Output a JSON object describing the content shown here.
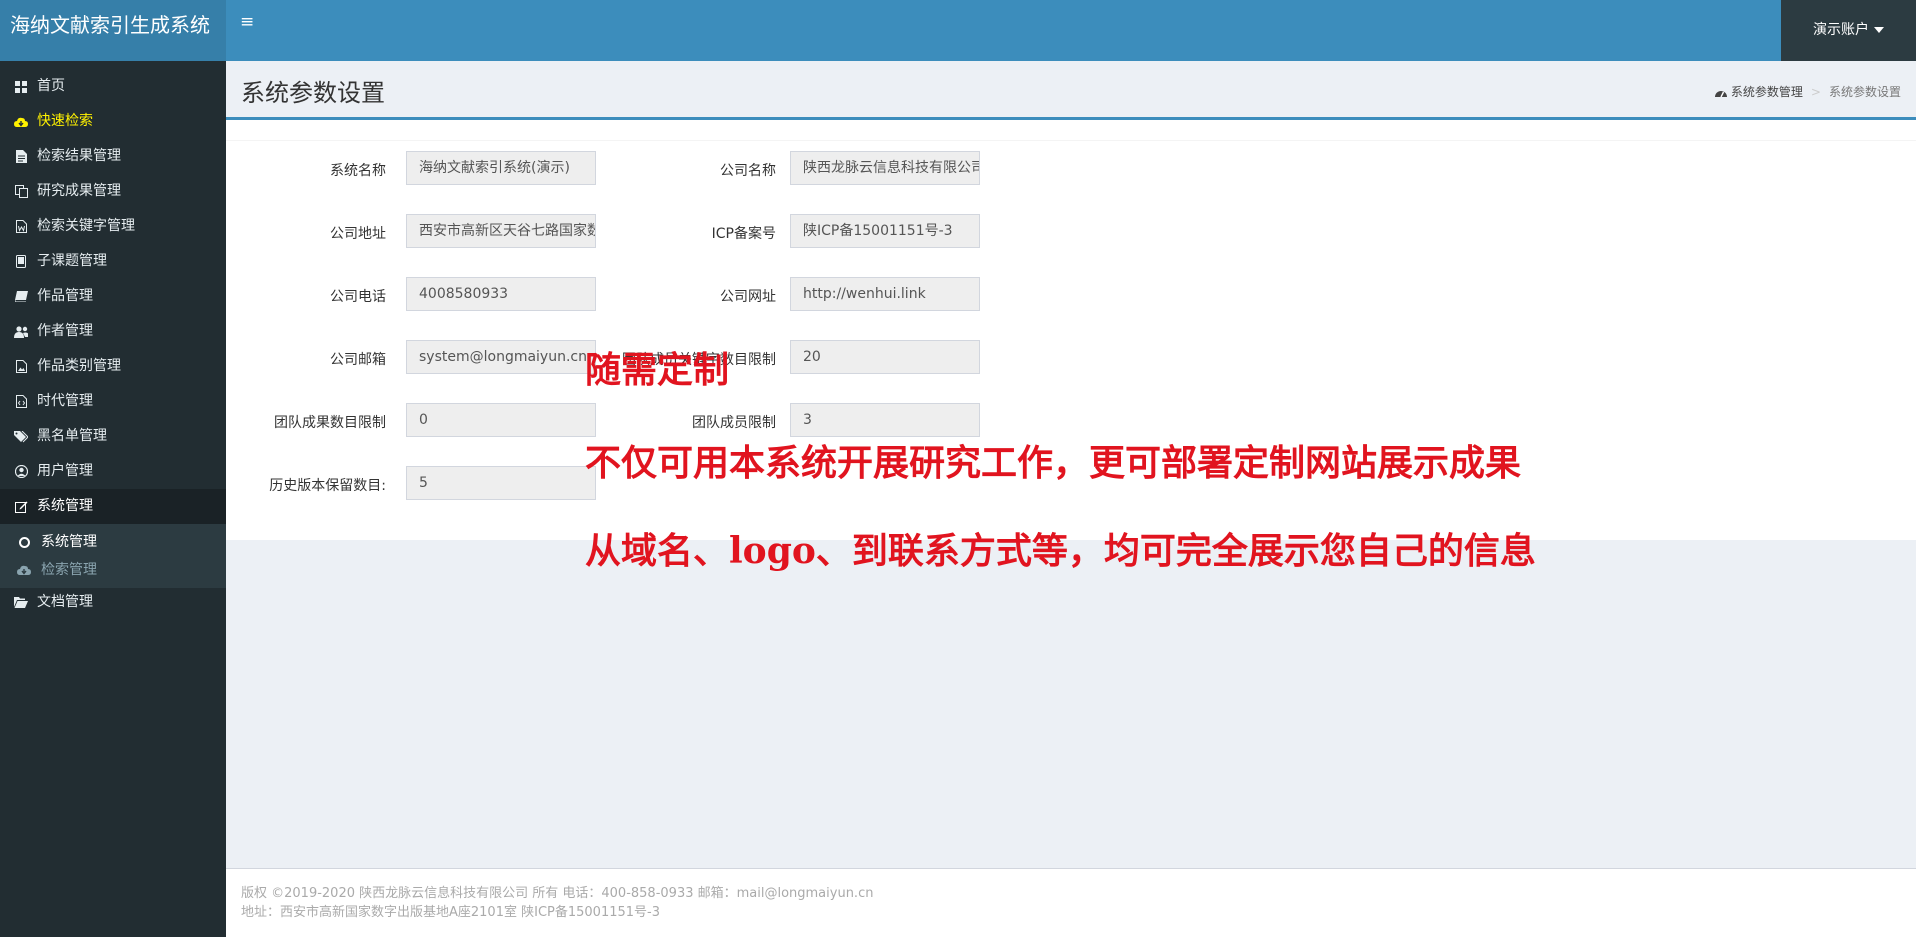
{
  "app": {
    "title": "海纳文献索引生成系统",
    "user_menu": "演示账户"
  },
  "sidebar": {
    "items": [
      {
        "label": "首页",
        "icon": "dashboard-icon"
      },
      {
        "label": "快速检索",
        "icon": "cloud-download-icon"
      },
      {
        "label": "检索结果管理",
        "icon": "file-text-icon"
      },
      {
        "label": "研究成果管理",
        "icon": "copy-icon"
      },
      {
        "label": "检索关键字管理",
        "icon": "file-word-icon"
      },
      {
        "label": "子课题管理",
        "icon": "tablet-icon"
      },
      {
        "label": "作品管理",
        "icon": "book-icon"
      },
      {
        "label": "作者管理",
        "icon": "users-icon"
      },
      {
        "label": "作品类别管理",
        "icon": "file-image-icon"
      },
      {
        "label": "时代管理",
        "icon": "file-code-icon"
      },
      {
        "label": "黑名单管理",
        "icon": "tags-icon"
      },
      {
        "label": "用户管理",
        "icon": "user-circle-icon"
      },
      {
        "label": "系统管理",
        "icon": "edit-icon"
      }
    ],
    "submenu": [
      {
        "label": "系统管理"
      },
      {
        "label": "检索管理"
      }
    ],
    "after": {
      "label": "文档管理",
      "icon": "folder-open-icon"
    },
    "highlight_color": "#fff100"
  },
  "page": {
    "title": "系统参数设置",
    "breadcrumb": [
      "系统参数管理",
      "系统参数设置"
    ]
  },
  "form": {
    "fields": [
      {
        "label": "系统名称",
        "value": "海纳文献索引系统(演示)"
      },
      {
        "label": "公司名称",
        "value": "陕西龙脉云信息科技有限公司"
      },
      {
        "label": "公司地址",
        "value": "西安市高新区天谷七路国家数字出版基地"
      },
      {
        "label": "ICP备案号",
        "value": "陕ICP备15001151号-3"
      },
      {
        "label": "公司电话",
        "value": "4008580933"
      },
      {
        "label": "公司网址",
        "value": "http://wenhui.link"
      },
      {
        "label": "公司邮箱",
        "value": "system@longmaiyun.cn"
      },
      {
        "label": "团队成员关键字数目限制",
        "value": "20"
      },
      {
        "label": "团队成果数目限制",
        "value": "0"
      },
      {
        "label": "团队成员限制",
        "value": "3"
      },
      {
        "label": "历史版本保留数目:",
        "value": "5"
      }
    ]
  },
  "promo": {
    "title": "随需定制",
    "line1": "不仅可用本系统开展研究工作，更可部署定制网站展示成果",
    "line2": "从域名、logo、到联系方式等，均可完全展示您自己的信息",
    "color": "#e1141f"
  },
  "footer": {
    "line1": "版权 ©2019-2020 陕西龙脉云信息科技有限公司 所有    电话：400-858-0933   邮箱：mail@longmaiyun.cn",
    "line2": "地址：西安市高新国家数字出版基地A座2101室    陕ICP备15001151号-3"
  },
  "colors": {
    "header": "#3c8dbc",
    "logo_bg": "#367fa9",
    "sidebar": "#222d32"
  }
}
